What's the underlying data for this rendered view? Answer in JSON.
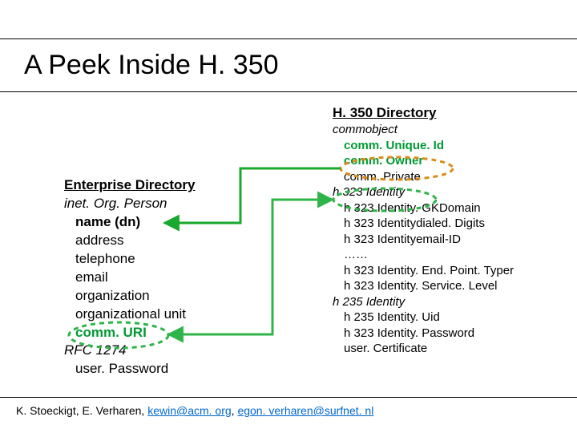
{
  "title": "A Peek Inside H. 350",
  "left": {
    "header": "Enterprise Directory",
    "class": "inet. Org. Person",
    "name_dn": "name (dn)",
    "address": "address",
    "telephone": "telephone",
    "email": "email",
    "organization": "organization",
    "org_unit": "organizational unit",
    "comm_uri": "comm. URI",
    "rfc": "RFC 1274",
    "user_password": "user. Password"
  },
  "right": {
    "header": "H. 350 Directory",
    "commobject": "commobject",
    "comm_unique_id": "comm. Unique. Id",
    "comm_owner": "comm. Owner",
    "comm_private": "comm. Private",
    "h323identity": "h 323 Identity",
    "gk_domain": "h 323 Identity. GKDomain",
    "dialed_digits": "h 323 Identitydialed. Digits",
    "email_id": "h 323 Identityemail-ID",
    "ellipsis": "……",
    "endpoint_typer": "h 323 Identity. End. Point. Typer",
    "service_level": "h 323 Identity. Service. Level",
    "h235identity": "h 235 Identity",
    "h235_uid": "h 235 Identity. Uid",
    "h323_password": "h 323 Identity. Password",
    "user_cert": "user. Certificate"
  },
  "footer": {
    "authors": "K. Stoeckigt, E. Verharen, ",
    "email1": "kewin@acm. org",
    "sep": ", ",
    "email2": "egon. verharen@surfnet. nl"
  },
  "colors": {
    "accent_green": "#2fb44a",
    "accent_orange": "#d98c1a",
    "arrow_green": "#1aa82e"
  }
}
